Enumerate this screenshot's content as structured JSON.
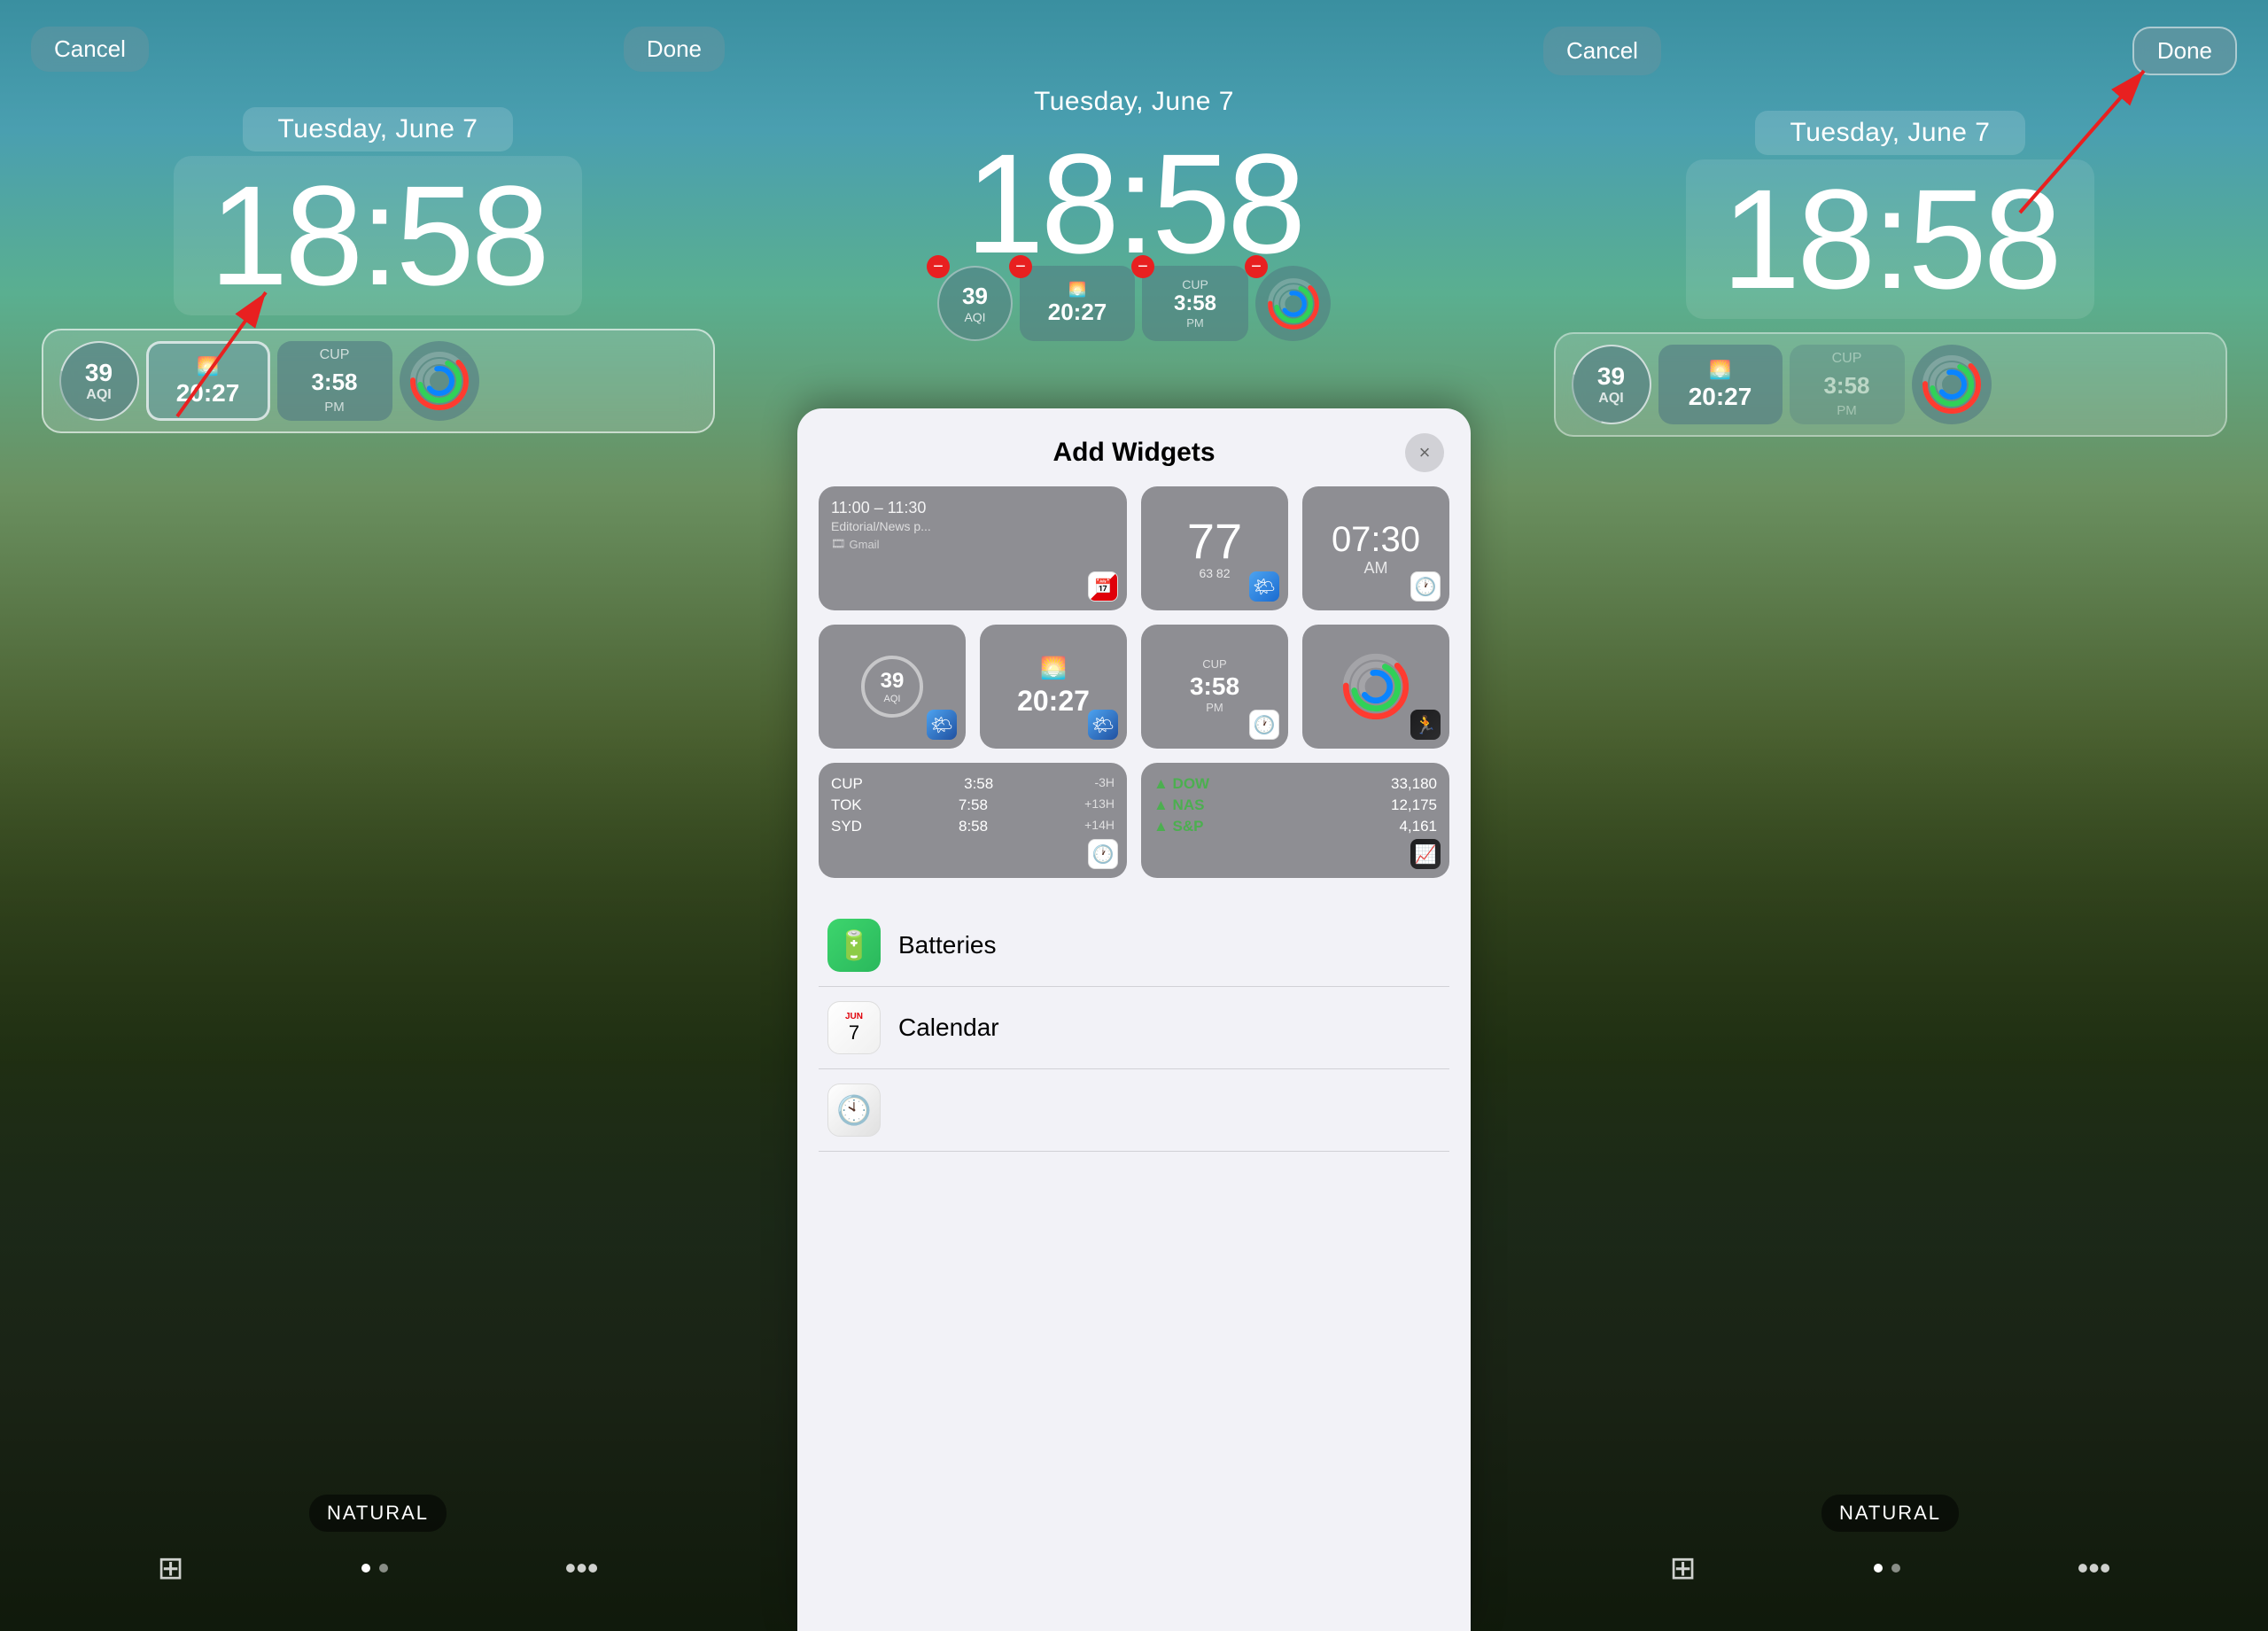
{
  "panels": {
    "left": {
      "cancel_label": "Cancel",
      "done_label": "Done",
      "date": "Tuesday, June 7",
      "time": "18:58",
      "widgets": {
        "aqi": "39",
        "aqi_label": "AQI",
        "clock_time": "20:27",
        "cup_label": "CUP",
        "cup_time": "3:58",
        "cup_pm": "PM"
      },
      "filter_label": "NATURAL"
    },
    "middle": {
      "date": "Tuesday, June 7",
      "time": "18:58",
      "modal": {
        "title": "Add Widgets",
        "close_label": "×",
        "widgets": [
          {
            "type": "calendar",
            "time": "11:00 – 11:30",
            "subtitle": "Editorial/News p...",
            "gmail": "Gmail"
          },
          {
            "type": "weather_temp",
            "temp": "77",
            "range": "63  82"
          },
          {
            "type": "clock_alarm",
            "time": "07:30",
            "ampm": "AM"
          },
          {
            "type": "aqi_widget",
            "value": "39",
            "label": "AQI"
          },
          {
            "type": "clock_sun",
            "time": "20:27"
          },
          {
            "type": "cup_clock",
            "label": "CUP",
            "time": "3:58",
            "ampm": "PM"
          },
          {
            "type": "ring_widget"
          },
          {
            "type": "timezone",
            "cities": [
              "CUP",
              "TOK",
              "SYD"
            ],
            "times": [
              "3:58",
              "7:58",
              "8:58"
            ],
            "diffs": [
              "-3H",
              "+13H",
              "+14H"
            ]
          },
          {
            "type": "stocks",
            "items": [
              {
                "name": "DOW",
                "value": "33,180"
              },
              {
                "name": "NAS",
                "value": "12,175"
              },
              {
                "name": "S&P",
                "value": "4,161"
              }
            ]
          }
        ],
        "apps": [
          {
            "name": "Batteries",
            "icon": "battery"
          },
          {
            "name": "Calendar",
            "icon": "calendar"
          }
        ]
      }
    },
    "right": {
      "cancel_label": "Cancel",
      "done_label": "Done",
      "date": "Tuesday, June 7",
      "time": "18:58",
      "filter_label": "NATURAL"
    }
  }
}
